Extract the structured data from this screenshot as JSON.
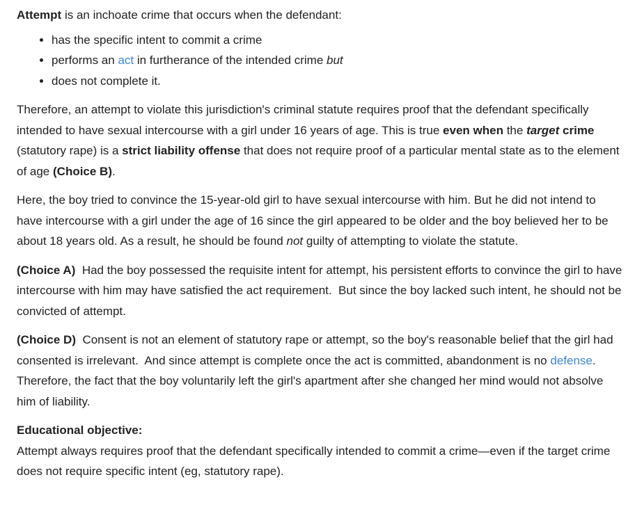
{
  "intro": {
    "term": "Attempt",
    "rest": " is an inchoate crime that occurs when the defendant:"
  },
  "bullets": {
    "b1": "has the specific intent to commit a crime",
    "b2_pre": "performs an ",
    "b2_link": "act",
    "b2_mid": " in furtherance of the intended crime ",
    "b2_italic": "but",
    "b3": "does not complete it."
  },
  "p1": {
    "t1": "Therefore, an attempt to violate this jurisdiction's criminal statute requires proof that the defendant specifically intended to have sexual intercourse with a girl under 16 years of age.  This is true ",
    "b1": "even when",
    "t2": " the ",
    "bi1": "target",
    "b2": " crime",
    "t3": " (statutory rape) is a ",
    "b3": "strict liability offense",
    "t4": " that does not require proof of a particular mental state as to the element of age ",
    "b4": "(Choice B)",
    "t5": "."
  },
  "p2": {
    "t1": "Here, the boy tried to convince the 15-year-old girl to have sexual intercourse with him.  But he did not intend to have intercourse with a girl under the age of 16 since the girl appeared to be older and the boy believed her to be about 18 years old.  As a result, he should be found ",
    "i1": "not",
    "t2": " guilty of attempting to violate the statute."
  },
  "p3": {
    "label": "(Choice A)",
    "text": "  Had the boy possessed the requisite intent for attempt, his persistent efforts to convince the girl to have intercourse with him may have satisfied the act requirement.  But since the boy lacked such intent, he should not be convicted of attempt."
  },
  "p4": {
    "label": "(Choice D)",
    "t1": "  Consent is not an element of statutory rape or attempt, so the boy's reasonable belief that the girl had consented is irrelevant.  And since attempt is complete once the act is committed, abandonment is no ",
    "link": "defense",
    "t2": ".  Therefore, the fact that the boy voluntarily left the girl's apartment after she changed her mind would not absolve him of liability."
  },
  "objective": {
    "title": "Educational objective:",
    "text": "Attempt always requires proof that the defendant specifically intended to commit a crime—even if the target crime does not require specific intent (eg, statutory rape)."
  },
  "colors": {
    "text": "#222222",
    "link": "#3b86d6",
    "background": "#ffffff"
  }
}
